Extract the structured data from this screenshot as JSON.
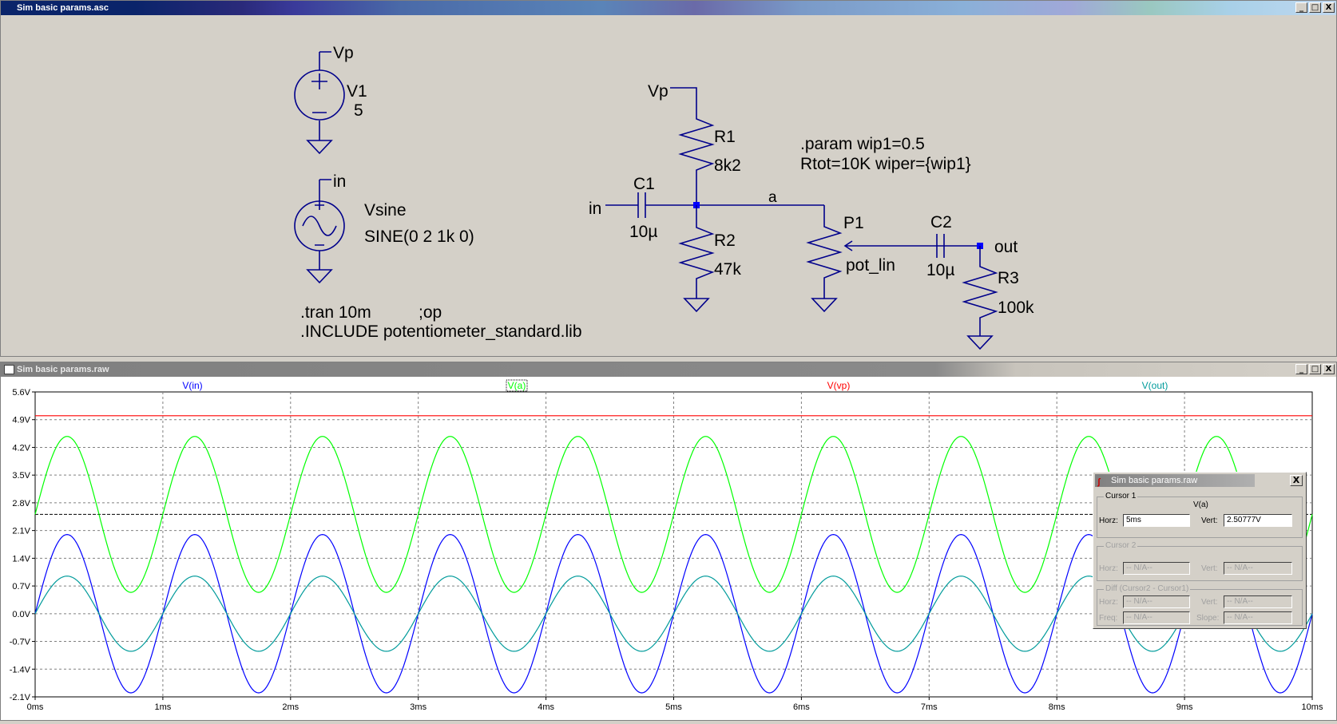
{
  "schematic_window": {
    "title": "Sim basic params.asc",
    "buttons": [
      "_",
      "□",
      "X"
    ],
    "labels": {
      "v1_net": "Vp",
      "v1_name": "V1",
      "v1_value": "5",
      "vsine_net": "in",
      "vsine_name": "Vsine",
      "vsine_value": "SINE(0 2 1k 0)",
      "tran": ".tran 10m",
      "op": ";op",
      "include": ".INCLUDE potentiometer_standard.lib",
      "vp_label": "Vp",
      "r1_name": "R1",
      "r1_value": "8k2",
      "c1_name": "C1",
      "c1_value": "10µ",
      "in_label": "in",
      "r2_name": "R2",
      "r2_value": "47k",
      "net_a": "a",
      "param_line1": ".param wip1=0.5",
      "param_line2": "Rtot=10K wiper={wip1}",
      "p1_name": "P1",
      "p1_value": "pot_lin",
      "c2_name": "C2",
      "c2_value": "10µ",
      "out_label": "out",
      "r3_name": "R3",
      "r3_value": "100k"
    }
  },
  "waveform_window": {
    "title": "Sim basic params.raw",
    "buttons": [
      "_",
      "□",
      "X"
    ]
  },
  "chart_data": {
    "type": "line",
    "xlabel": "",
    "ylabel": "",
    "x_ticks": [
      "0ms",
      "1ms",
      "2ms",
      "3ms",
      "4ms",
      "5ms",
      "6ms",
      "7ms",
      "8ms",
      "9ms",
      "10ms"
    ],
    "y_ticks": [
      "5.6V",
      "4.9V",
      "4.2V",
      "3.5V",
      "2.8V",
      "2.1V",
      "1.4V",
      "0.7V",
      "0.0V",
      "-0.7V",
      "-1.4V",
      "-2.1V"
    ],
    "xlim": [
      0,
      10
    ],
    "ylim": [
      -2.1,
      5.6
    ],
    "grid": true,
    "cursor_level": 2.50777,
    "series": [
      {
        "name": "V(in)",
        "color": "#0000ff",
        "offset": 0,
        "amplitude": 2.0,
        "freq_khz": 1
      },
      {
        "name": "V(a)",
        "color": "#00ff00",
        "offset": 2.508,
        "amplitude": 1.97,
        "freq_khz": 1
      },
      {
        "name": "V(vp)",
        "color": "#ff0000",
        "offset": 5.0,
        "amplitude": 0,
        "freq_khz": 1
      },
      {
        "name": "V(out)",
        "color": "#009b9b",
        "offset": 0,
        "amplitude": 0.95,
        "freq_khz": 1
      }
    ]
  },
  "cursor_dialog": {
    "title": "Sim basic params.raw",
    "close": "X",
    "cursor1": {
      "group": "Cursor 1",
      "trace": "V(a)",
      "horz_label": "Horz:",
      "horz": "5ms",
      "vert_label": "Vert:",
      "vert": "2.50777V"
    },
    "cursor2": {
      "group": "Cursor 2",
      "horz_label": "Horz:",
      "horz": "-- N/A--",
      "vert_label": "Vert:",
      "vert": "-- N/A--"
    },
    "diff": {
      "group": "Diff (Cursor2 - Cursor1)",
      "horz_label": "Horz:",
      "horz": "-- N/A--",
      "vert_label": "Vert:",
      "vert": "-- N/A--",
      "freq_label": "Freq:",
      "freq": "-- N/A--",
      "slope_label": "Slope:",
      "slope": "-- N/A--"
    }
  }
}
